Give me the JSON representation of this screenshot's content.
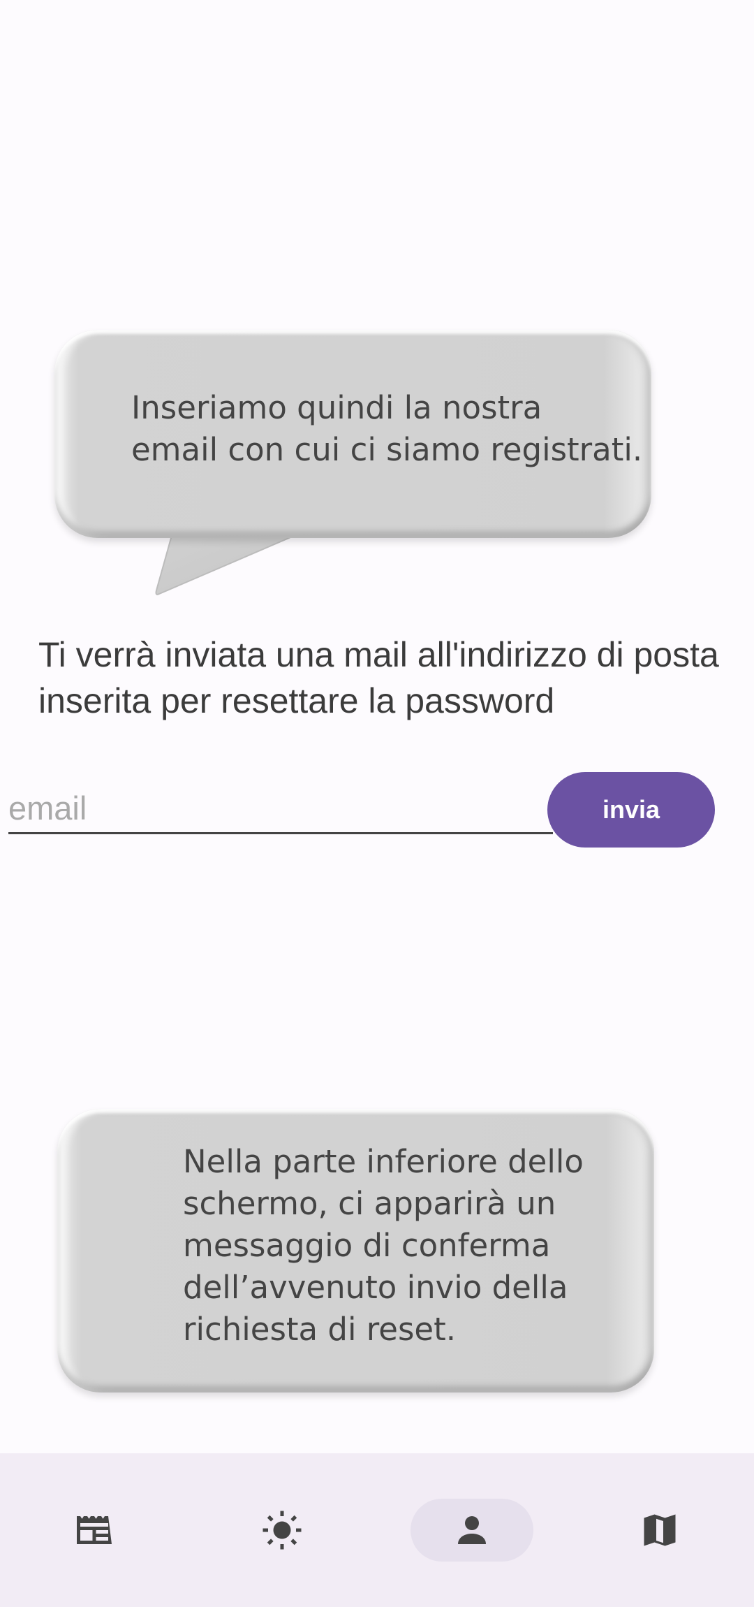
{
  "bubbles": {
    "top_text": "Inseriamo quindi la nostra\nemail con cui ci siamo registrati.",
    "bottom_text": "Nella parte inferiore dello\nschermo, ci apparirà un\nmessaggio di conferma\ndell’avvenuto invio della\nrichiesta di reset."
  },
  "form": {
    "info_text": "Ti verrà inviata una mail all'indirizzo di posta inserita per resettare la password",
    "email_placeholder": "email",
    "email_value": "",
    "send_label": "invia"
  },
  "colors": {
    "accent": "#6b52a3",
    "nav_background": "#f2ecf5",
    "nav_active": "#e6e0ed"
  },
  "bottom_nav": {
    "items": [
      {
        "icon": "news-icon",
        "active": false
      },
      {
        "icon": "sun-icon",
        "active": false
      },
      {
        "icon": "person-icon",
        "active": true
      },
      {
        "icon": "map-icon",
        "active": false
      }
    ]
  }
}
